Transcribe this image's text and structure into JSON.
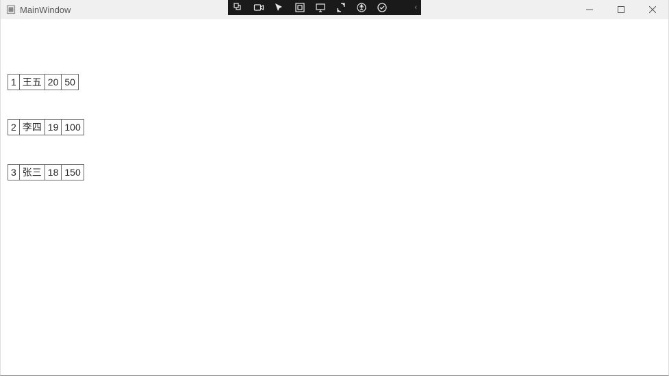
{
  "window": {
    "title": "MainWindow"
  },
  "vs_toolbar": {
    "icons": [
      "live-visual-tree-icon",
      "screen-recorder-icon",
      "select-element-icon",
      "display-layout-icon",
      "track-focus-icon",
      "hot-reload-icon",
      "accessibility-icon",
      "check-icon"
    ],
    "chevron": "‹"
  },
  "rows": [
    {
      "cells": [
        "1",
        "王五",
        "20",
        "50"
      ]
    },
    {
      "cells": [
        "2",
        "李四",
        "19",
        "100"
      ]
    },
    {
      "cells": [
        "3",
        "张三",
        "18",
        "150"
      ]
    }
  ]
}
